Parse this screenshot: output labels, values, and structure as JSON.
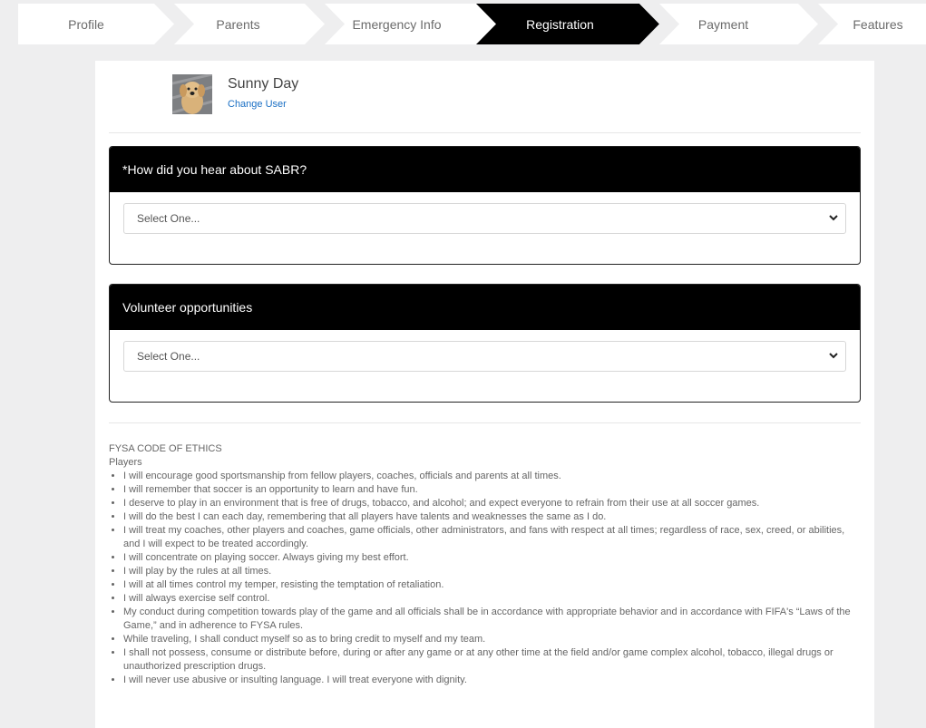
{
  "steps": [
    {
      "label": "Profile"
    },
    {
      "label": "Parents"
    },
    {
      "label": "Emergency Info"
    },
    {
      "label": "Registration"
    },
    {
      "label": "Payment"
    },
    {
      "label": "Features"
    }
  ],
  "active_step": "Registration",
  "user": {
    "name": "Sunny Day",
    "change_label": "Change User",
    "avatar_icon": "dog-photo"
  },
  "questions": [
    {
      "title": "*How did you hear about SABR?",
      "selected": "Select One..."
    },
    {
      "title": "Volunteer opportunities",
      "selected": "Select One..."
    }
  ],
  "ethics": {
    "heading": "FYSA CODE OF ETHICS",
    "subheading": "Players",
    "items": [
      "I will encourage good sportsmanship from fellow players, coaches, officials and parents at all times.",
      "I will remember that soccer is an opportunity to learn and have fun.",
      "I deserve to play in an environment that is free of drugs, tobacco, and alcohol; and expect everyone to refrain from their use at all soccer games.",
      "I will do the best I can each day, remembering that all players have talents and weaknesses the same as I do.",
      "I will treat my coaches, other players and coaches, game officials, other administrators, and fans with respect at all times; regardless of race, sex, creed, or abilities, and I will expect to be treated accordingly.",
      "I will concentrate on playing soccer. Always giving my best effort.",
      "I will play by the rules at all times.",
      "I will at all times control my temper, resisting the temptation of retaliation.",
      "I will always exercise self control.",
      "My conduct during competition towards play of the game and all officials shall be in accordance with appropriate behavior and in accordance with FIFA's “Laws of the Game,” and in adherence to FYSA rules.",
      "While traveling, I shall conduct myself so as to bring credit to myself and my team.",
      "I shall not possess, consume or distribute before, during or after any game or at any other time at the field and/or game complex alcohol, tobacco, illegal drugs or unauthorized prescription drugs.",
      "I will never use abusive or insulting language. I will treat everyone with dignity."
    ]
  },
  "colors": {
    "active_step_bg": "#000000",
    "link": "#1a6fc4",
    "panel_header_bg": "#000000"
  }
}
